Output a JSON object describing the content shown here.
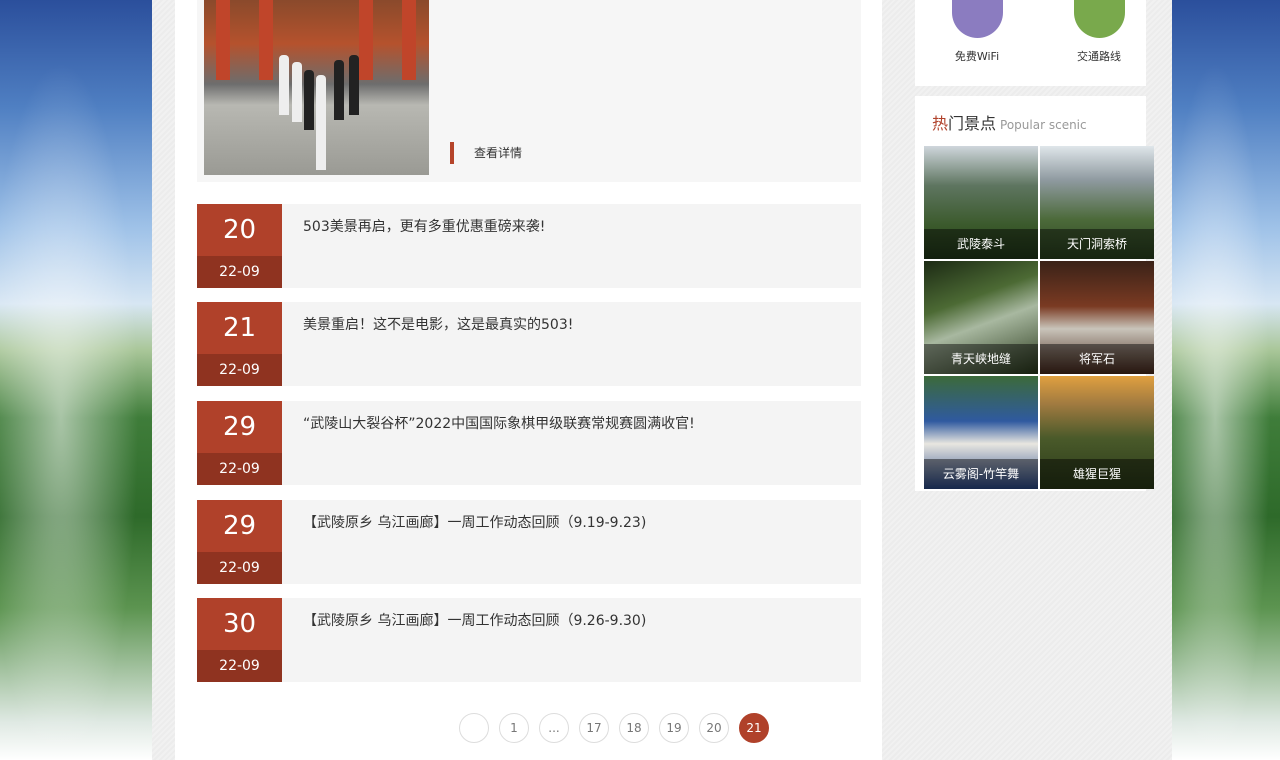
{
  "featured": {
    "more_label": "查看详情"
  },
  "news": [
    {
      "day": "20",
      "ym": "22-09",
      "title": "503美景再启，更有多重优惠重磅来袭!"
    },
    {
      "day": "21",
      "ym": "22-09",
      "title": "美景重启！这不是电影，这是最真实的503!"
    },
    {
      "day": "29",
      "ym": "22-09",
      "title": "“武陵山大裂谷杯”2022中国国际象棋甲级联赛常规赛圆满收官!"
    },
    {
      "day": "29",
      "ym": "22-09",
      "title": "【武陵原乡 乌江画廊】一周工作动态回顾（9.19-9.23)"
    },
    {
      "day": "30",
      "ym": "22-09",
      "title": "【武陵原乡 乌江画廊】一周工作动态回顾（9.26-9.30)"
    }
  ],
  "pagination": {
    "pages": [
      "",
      "1",
      "...",
      "17",
      "18",
      "19",
      "20",
      "21"
    ],
    "current": "21"
  },
  "services": [
    {
      "label": "免费WiFi",
      "color": "#8b7cc0"
    },
    {
      "label": "交通路线",
      "color": "#79a94c"
    }
  ],
  "hot_scenic": {
    "title_red": "热",
    "title_rest": "门景点",
    "title_en": "Popular scenic",
    "items": [
      {
        "name": "武陵泰斗"
      },
      {
        "name": "天门洞索桥"
      },
      {
        "name": "青天峡地缝"
      },
      {
        "name": "将军石"
      },
      {
        "name": "云雾阁-竹竿舞"
      },
      {
        "name": "雄猩巨猩"
      }
    ]
  },
  "colors": {
    "accent": "#b0412a",
    "accent_dark": "#8f3320"
  }
}
